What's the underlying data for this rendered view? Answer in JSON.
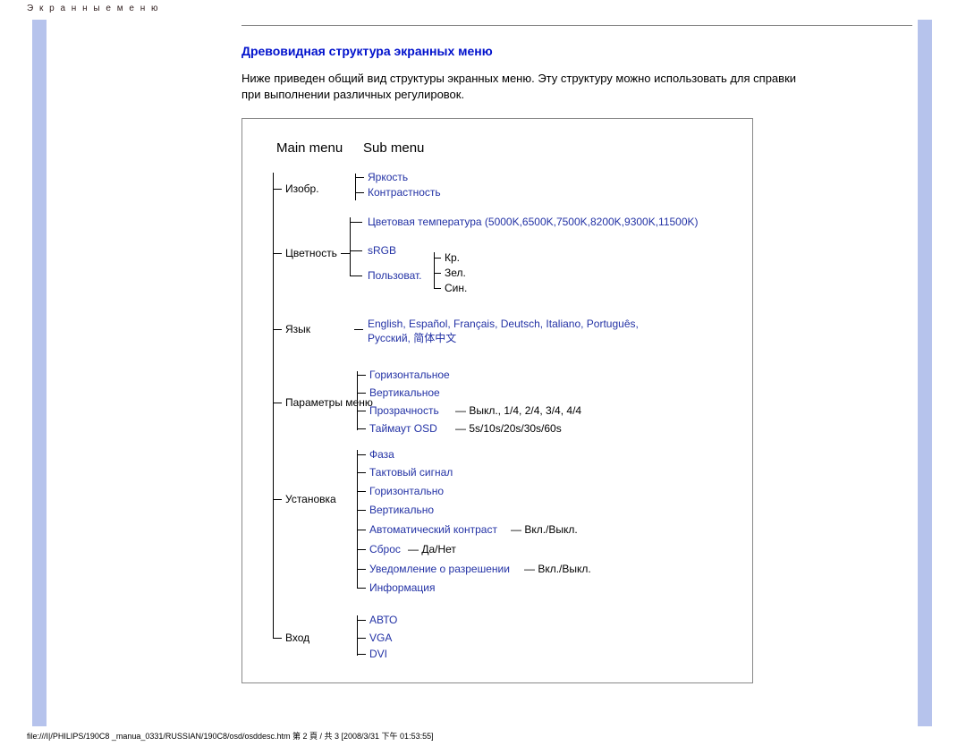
{
  "pageHeader": "Э к р а н н ы е   м е н ю",
  "sectionTitle": "Древовидная структура экранных меню",
  "intro": "Ниже приведен общий вид структуры экранных меню. Эту структуру можно использовать для справки при выполнении различных регулировок.",
  "colMain": "Main menu",
  "colSub": "Sub menu",
  "main": {
    "image": "Изобр.",
    "color": "Цветность",
    "language": "Язык",
    "osd": "Параметры меню",
    "setup": "Установка",
    "input": "Вход"
  },
  "image": {
    "brightness": "Яркость",
    "contrast": "Контрастность"
  },
  "color": {
    "temp": "Цветовая температура (5000K,6500K,7500K,8200K,9300K,11500K)",
    "sRGB": "sRGB",
    "user": "Пользоват.",
    "r": "Кр.",
    "g": "Зел.",
    "b": "Син."
  },
  "lang": "English, Español, Français, Deutsch, Italiano, Português, Русский, 简体中文",
  "osd": {
    "horiz": "Горизонтальное",
    "vert": "Вертикальное",
    "trans": "Прозрачность",
    "transv": "—   Выкл., 1/4, 2/4, 3/4, 4/4",
    "timeout": "Таймаут OSD",
    "timeoutv": "—   5s/10s/20s/30s/60s"
  },
  "setup": {
    "phase": "Фаза",
    "clock": "Тактовый сигнал",
    "horiz": "Горизонтально",
    "vert": "Вертикально",
    "auto": "Автоматический контраст",
    "autov": "—   Вкл./Выкл.",
    "reset": "Сброс",
    "resetv": "— Да/Нет",
    "res": "Уведомление о разрешении",
    "resv": "—   Вкл./Выкл.",
    "info": "Информация"
  },
  "input": {
    "auto": "АВТО",
    "vga": "VGA",
    "dvi": "DVI"
  },
  "footer": "file:///I|/PHILIPS/190C8 _manua_0331/RUSSIAN/190C8/osd/osddesc.htm 第 2 頁 / 共 3  [2008/3/31 下午 01:53:55]"
}
